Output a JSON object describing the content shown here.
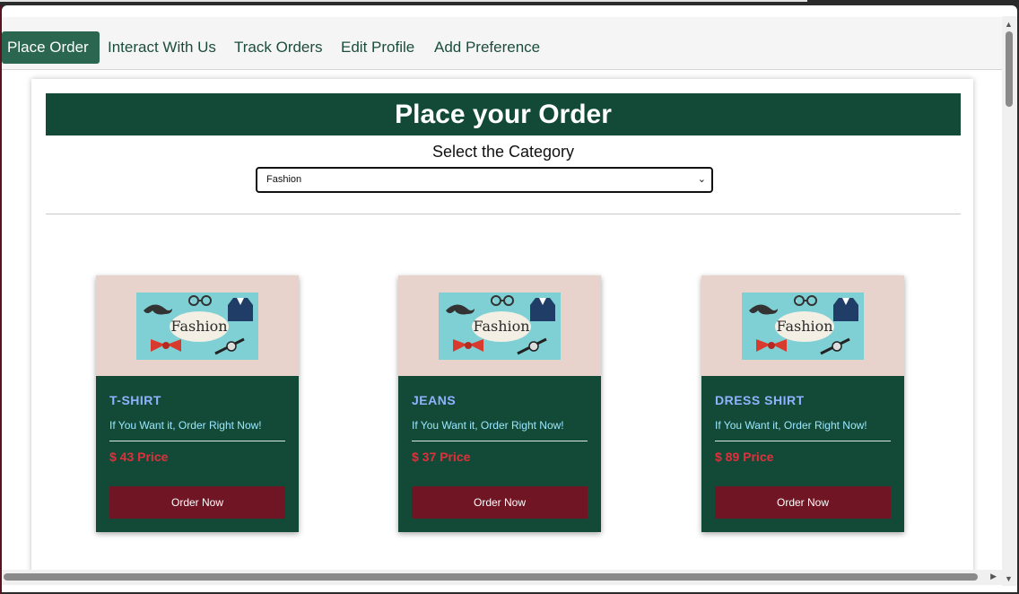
{
  "nav": {
    "items": [
      {
        "label": "Place Order",
        "active": true
      },
      {
        "label": "Interact With Us"
      },
      {
        "label": "Track Orders"
      },
      {
        "label": "Edit Profile"
      },
      {
        "label": "Add Preference"
      }
    ]
  },
  "main": {
    "title": "Place your Order",
    "category_label": "Select the Category",
    "category_selected": "Fashion",
    "image_text": "Fashion"
  },
  "products": [
    {
      "name": "T-SHIRT",
      "tagline": "If You Want it, Order Right Now!",
      "price": "$ 43 Price",
      "button": "Order Now"
    },
    {
      "name": "JEANS",
      "tagline": "If You Want it, Order Right Now!",
      "price": "$ 37 Price",
      "button": "Order Now"
    },
    {
      "name": "DRESS SHIRT",
      "tagline": "If You Want it, Order Right Now!",
      "price": "$ 89 Price",
      "button": "Order Now"
    }
  ],
  "colors": {
    "banner": "#124a37",
    "nav_active": "#2a6650",
    "card_body": "#124a37",
    "button": "#701524",
    "price": "#e0303b",
    "image_bg": "#e8d3cc"
  }
}
